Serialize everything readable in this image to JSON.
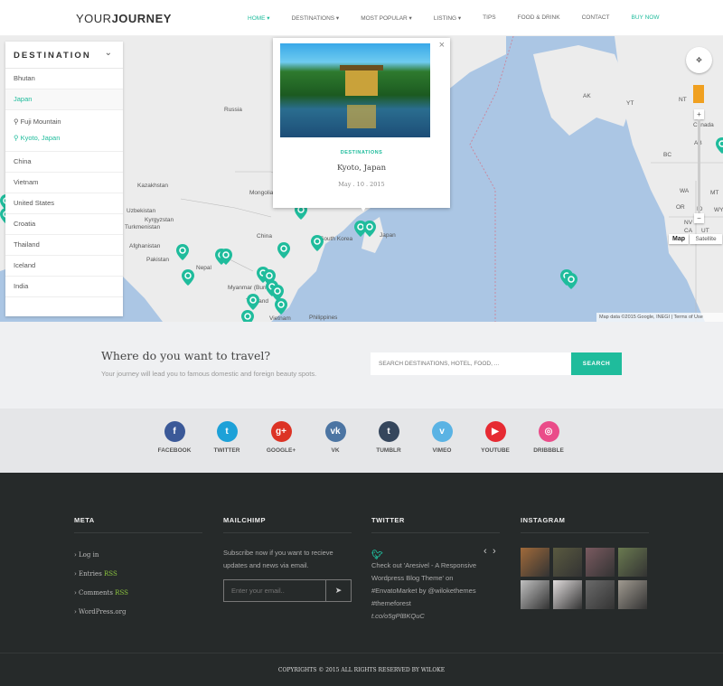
{
  "header": {
    "logo_light": "YOUR",
    "logo_bold": "JOURNEY",
    "nav": [
      {
        "label": "HOME ▾",
        "active": true
      },
      {
        "label": "DESTINATIONS ▾"
      },
      {
        "label": "MOST POPULAR ▾"
      },
      {
        "label": "LISTING ▾"
      },
      {
        "label": "TIPS"
      },
      {
        "label": "FOOD & DRINK"
      },
      {
        "label": "CONTACT"
      },
      {
        "label": "BUY NOW",
        "active": true
      }
    ]
  },
  "map": {
    "labels": [
      "Russia",
      "Kazakhstan",
      "Mongolia",
      "China",
      "Uzbekistan",
      "Kyrgyzstan",
      "Afghanistan",
      "Pakistan",
      "Nepal",
      "Myanmar (Burma)",
      "Thailand",
      "Vietnam",
      "Philippines",
      "South Korea",
      "Japan",
      "Canada",
      "AK",
      "YT",
      "NT",
      "BC",
      "AB",
      "WA",
      "MT",
      "OR",
      "ID",
      "WY",
      "NV",
      "UT",
      "CA",
      "Turkmenistan",
      "China"
    ],
    "attribution": "Map data ©2015 Google, INEGI",
    "terms": "Terms of Use",
    "type_map": "Map",
    "type_satellite": "Satellite",
    "zoom_in": "+",
    "zoom_out": "−"
  },
  "sidebar": {
    "title": "DESTINATION",
    "items": [
      {
        "label": "Bhutan"
      },
      {
        "label": "Japan",
        "active": true
      }
    ],
    "subitems": [
      {
        "label": "Fuji Mountain"
      },
      {
        "label": "Kyoto, Japan",
        "active": true
      }
    ],
    "more": [
      "China",
      "Vietnam",
      "United States",
      "Croatia",
      "Thailand",
      "Iceland",
      "India"
    ]
  },
  "popup": {
    "category": "DESTINATIONS",
    "title": "Kyoto, Japan",
    "date": "May . 10 . 2015",
    "close": "×"
  },
  "search": {
    "title": "Where do you want to travel?",
    "subtitle": "Your journey will lead you to famous domestic and foreign beauty spots.",
    "placeholder": "SEARCH DESTINATIONS, HOTEL, FOOD, ...",
    "button": "SEARCH"
  },
  "social": [
    {
      "label": "FACEBOOK",
      "glyph": "f",
      "color": "#3b5998"
    },
    {
      "label": "TWITTER",
      "glyph": "t",
      "color": "#1da1d8"
    },
    {
      "label": "GOOGLE+",
      "glyph": "g+",
      "color": "#dc3325"
    },
    {
      "label": "VK",
      "glyph": "vk",
      "color": "#4c75a3"
    },
    {
      "label": "TUMBLR",
      "glyph": "t",
      "color": "#35465c"
    },
    {
      "label": "VIMEO",
      "glyph": "v",
      "color": "#5ab3e4"
    },
    {
      "label": "YOUTUBE",
      "glyph": "▶",
      "color": "#e62b33"
    },
    {
      "label": "DRIBBBLE",
      "glyph": "◎",
      "color": "#ea4c89"
    }
  ],
  "footer": {
    "meta": {
      "title": "META",
      "items": [
        {
          "label": "Log in"
        },
        {
          "label": "Entries ",
          "rss": "RSS"
        },
        {
          "label": "Comments ",
          "rss": "RSS"
        },
        {
          "label": "WordPress.org"
        }
      ]
    },
    "mailchimp": {
      "title": "MAILCHIMP",
      "text": "Subscribe now if you want to recieve updates and news via email.",
      "placeholder": "Enter your email.."
    },
    "twitter": {
      "title": "TWITTER",
      "tweet": "Check out 'Aresivel - A Responsive Wordpress Blog Theme' on #EnvatoMarket by @wilokethemes #themeforest",
      "link": "t.co/o5gPlBKQuC",
      "prev": "‹",
      "next": "›"
    },
    "instagram": {
      "title": "INSTAGRAM",
      "photo_colors": [
        "#a06a3a",
        "#5a5a40",
        "#7a5a60",
        "#6a7a50",
        "#c0c0c0",
        "#e0dcdc",
        "#6a6a6a",
        "#a09a90"
      ]
    },
    "copyright": "COPYRIGHTS © 2015 ALL RIGHTS RESERVED BY WILOKE"
  },
  "accent": "#1fbc9c"
}
